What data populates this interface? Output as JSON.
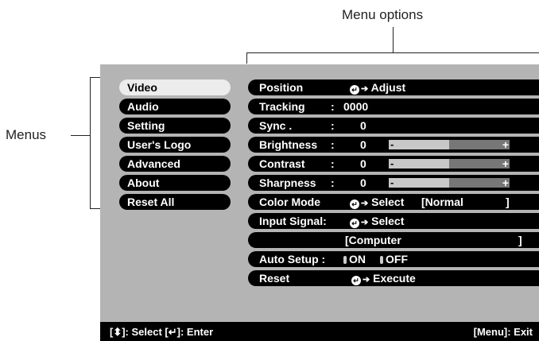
{
  "annotations": {
    "menu_options_label": "Menu options",
    "menus_label": "Menus"
  },
  "menus": [
    {
      "label": "Video",
      "selected": true
    },
    {
      "label": "Audio",
      "selected": false
    },
    {
      "label": "Setting",
      "selected": false
    },
    {
      "label": "User's Logo",
      "selected": false
    },
    {
      "label": "Advanced",
      "selected": false
    },
    {
      "label": "About",
      "selected": false
    },
    {
      "label": "Reset All",
      "selected": false
    }
  ],
  "options": {
    "position": {
      "label": "Position",
      "action": "Adjust"
    },
    "tracking": {
      "label": "Tracking",
      "sep": ":",
      "value": "0000"
    },
    "sync": {
      "label": "Sync .",
      "sep": ":",
      "value": "0"
    },
    "brightness": {
      "label": "Brightness",
      "sep": ":",
      "value": "0",
      "level": 0.5
    },
    "contrast": {
      "label": "Contrast",
      "sep": ":",
      "value": "0",
      "level": 0.5
    },
    "sharpness": {
      "label": "Sharpness",
      "sep": ":",
      "value": "0",
      "level": 0.5
    },
    "color_mode": {
      "label": "Color Mode",
      "action": "Select",
      "current": "[Normal",
      "close": "]"
    },
    "input_signal": {
      "label": "Input Signal:",
      "action": "Select"
    },
    "input_current": {
      "value": "[Computer",
      "close": "]"
    },
    "auto_setup": {
      "label": "Auto Setup :",
      "on": "ON",
      "off": "OFF"
    },
    "reset": {
      "label": "Reset",
      "action": "Execute"
    }
  },
  "slider_minus": "-",
  "slider_plus": "+",
  "status": {
    "left": "[⬍]: Select  [↵]: Enter",
    "right": "[Menu]: Exit"
  },
  "colors": {
    "panel": "#b4b4b4",
    "bar": "#000000",
    "selected": "#ececec"
  }
}
